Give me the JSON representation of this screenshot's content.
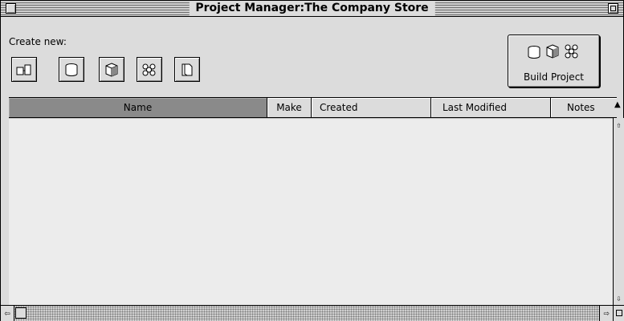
{
  "window": {
    "title": "Project Manager:The Company Store"
  },
  "create": {
    "label": "Create new:",
    "tools": [
      {
        "icon": "document-icon"
      },
      {
        "icon": "database-icon"
      },
      {
        "icon": "cube-icon"
      },
      {
        "icon": "network-icon"
      },
      {
        "icon": "folder-icon"
      }
    ]
  },
  "build": {
    "label": "Build Project"
  },
  "table": {
    "columns": [
      "Name",
      "Make",
      "Created",
      "Last Modified",
      "Notes"
    ],
    "rows": []
  },
  "scroll": {
    "up": "⇧",
    "down": "⇩",
    "left": "⇦",
    "right": "⇨"
  }
}
